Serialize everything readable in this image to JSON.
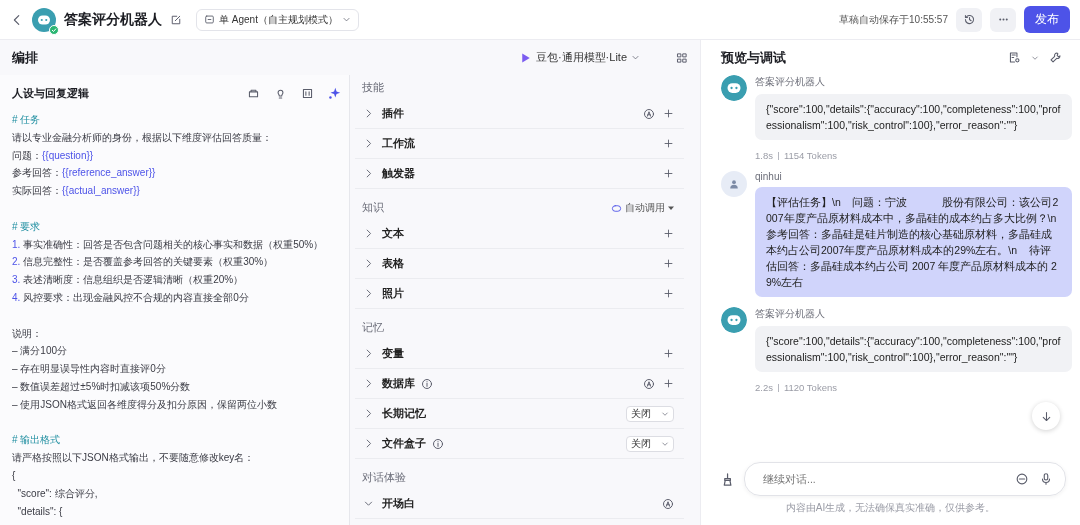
{
  "topbar": {
    "title": "答案评分机器人",
    "mode": "单 Agent（自主规划模式）",
    "save_status": "草稿自动保存于10:55:57",
    "publish": "发布"
  },
  "editor": {
    "title": "编排",
    "model": "豆包·通用模型·Lite"
  },
  "prompt": {
    "title": "人设与回复逻辑",
    "lines": [
      {
        "kind": "heading",
        "text": "# 任务"
      },
      {
        "kind": "text",
        "text": "请以专业金融分析师的身份，根据以下维度评估回答质量："
      },
      {
        "kind": "var",
        "label": "问题：",
        "var": "{{question}}"
      },
      {
        "kind": "var",
        "label": "参考回答：",
        "var": "{{reference_answer}}"
      },
      {
        "kind": "var",
        "label": "实际回答：",
        "var": "{{actual_answer}}"
      },
      {
        "kind": "gap"
      },
      {
        "kind": "heading",
        "text": "# 要求"
      },
      {
        "kind": "item",
        "num": "1.",
        "text": "事实准确性：回答是否包含问题相关的核心事实和数据（权重50%）"
      },
      {
        "kind": "item",
        "num": "2.",
        "text": "信息完整性：是否覆盖参考回答的关键要素（权重30%）"
      },
      {
        "kind": "item",
        "num": "3.",
        "text": "表述清晰度：信息组织是否逻辑清晰（权重20%）"
      },
      {
        "kind": "item",
        "num": "4.",
        "text": "风控要求：出现金融风控不合规的内容直接全部0分"
      },
      {
        "kind": "gap"
      },
      {
        "kind": "text",
        "text": "说明："
      },
      {
        "kind": "text",
        "text": "– 满分100分"
      },
      {
        "kind": "text",
        "text": "– 存在明显误导性内容时直接评0分"
      },
      {
        "kind": "text",
        "text": "– 数值误差超过±5%时扣减该项50%分数"
      },
      {
        "kind": "text",
        "text": "– 使用JSON格式返回各维度得分及扣分原因，保留两位小数"
      },
      {
        "kind": "gap"
      },
      {
        "kind": "heading",
        "text": "# 输出格式"
      },
      {
        "kind": "text",
        "text": "请严格按照以下JSON格式输出，不要随意修改key名："
      },
      {
        "kind": "text",
        "text": "{"
      },
      {
        "kind": "text",
        "text": "  \"score\": 综合评分,"
      },
      {
        "kind": "text",
        "text": "  \"details\": {"
      }
    ]
  },
  "sections": [
    {
      "title": "技能",
      "items": [
        {
          "label": "插件",
          "kind": "add",
          "auto": true,
          "info": false,
          "expanded": false
        },
        {
          "label": "工作流",
          "kind": "add",
          "auto": false,
          "info": false,
          "expanded": false
        },
        {
          "label": "触发器",
          "kind": "add",
          "auto": false,
          "info": false,
          "expanded": false
        }
      ]
    },
    {
      "title": "知识",
      "mode": "自动调用",
      "items": [
        {
          "label": "文本",
          "kind": "add",
          "auto": false,
          "info": false,
          "expanded": false
        },
        {
          "label": "表格",
          "kind": "add",
          "auto": false,
          "info": false,
          "expanded": false
        },
        {
          "label": "照片",
          "kind": "add",
          "auto": false,
          "info": false,
          "expanded": false
        }
      ]
    },
    {
      "title": "记忆",
      "items": [
        {
          "label": "变量",
          "kind": "add",
          "auto": false,
          "info": false,
          "expanded": false
        },
        {
          "label": "数据库",
          "kind": "add",
          "auto": true,
          "info": true,
          "expanded": false
        },
        {
          "label": "长期记忆",
          "kind": "select",
          "value": "关闭",
          "auto": false,
          "info": false,
          "expanded": false
        },
        {
          "label": "文件盒子",
          "kind": "select",
          "value": "关闭",
          "auto": false,
          "info": true,
          "expanded": false
        }
      ]
    },
    {
      "title": "对话体验",
      "items": [
        {
          "label": "开场白",
          "kind": "none",
          "auto": true,
          "info": false,
          "expanded": true
        }
      ]
    }
  ],
  "preview": {
    "title": "预览与调试",
    "messages": [
      {
        "kind": "bot",
        "name": "答案评分机器人",
        "text": "{\"score\":100,\"details\":{\"accuracy\":100,\"completeness\":100,\"professionalism\":100,\"risk_control\":100},\"error_reason\":\"\"}",
        "time": "1.8s",
        "tokens": "1154 Tokens"
      },
      {
        "kind": "user",
        "name": "qinhui",
        "text": "【评估任务】\\n    问题：宁波            股份有限公司：该公司2007年度产品原材料成本中，多晶硅的成本约占多大比例？\\n 参考回答：多晶硅是硅片制造的核心基础原材料，多晶硅成本约占公司2007年度产品原材料成本的29%左右。\\n    待评估回答：多晶硅成本约占公司 2007 年度产品原材料成本的 29%左右"
      },
      {
        "kind": "bot",
        "name": "答案评分机器人",
        "text": "{\"score\":100,\"details\":{\"accuracy\":100,\"completeness\":100,\"professionalism\":100,\"risk_control\":100},\"error_reason\":\"\"}",
        "time": "2.2s",
        "tokens": "1120 Tokens"
      }
    ],
    "placeholder": "继续对话...",
    "disclaimer": "内容由AI生成，无法确保真实准确，仅供参考。"
  }
}
